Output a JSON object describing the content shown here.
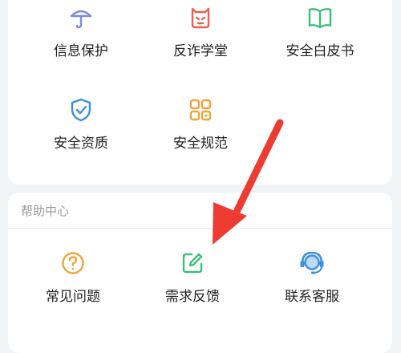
{
  "security_services": {
    "items": [
      {
        "label": "信息保护",
        "icon": "umbrella-icon",
        "color": "#7b8cde"
      },
      {
        "label": "反诈学堂",
        "icon": "robot-face-icon",
        "color": "#e8614f"
      },
      {
        "label": "安全白皮书",
        "icon": "open-book-icon",
        "color": "#3dbf78"
      },
      {
        "label": "安全资质",
        "icon": "shield-check-icon",
        "color": "#3d8fe0"
      },
      {
        "label": "安全规范",
        "icon": "grid-apps-icon",
        "color": "#f0a43a"
      }
    ]
  },
  "help_center": {
    "title": "帮助中心",
    "items": [
      {
        "label": "常见问题",
        "icon": "question-circle-icon",
        "color": "#f0a43a"
      },
      {
        "label": "需求反馈",
        "icon": "edit-note-icon",
        "color": "#3dbf78"
      },
      {
        "label": "联系客服",
        "icon": "headset-icon",
        "color": "#3d8fe0"
      }
    ]
  },
  "annotation": {
    "arrow_color": "#ee3b32"
  }
}
